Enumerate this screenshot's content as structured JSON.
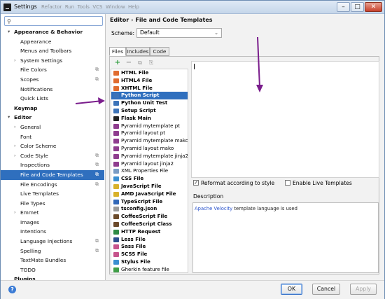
{
  "window": {
    "title": "Settings",
    "ghost_menu": "Refactor  Run  Tools  VCS  Window  Help"
  },
  "search": {
    "placeholder": "",
    "value": ""
  },
  "tree": [
    {
      "label": "Appearance & Behavior",
      "level": 0,
      "expanded": true,
      "bold": true
    },
    {
      "label": "Appearance",
      "level": 1
    },
    {
      "label": "Menus and Toolbars",
      "level": 1
    },
    {
      "label": "System Settings",
      "level": 1,
      "collapsed": true
    },
    {
      "label": "File Colors",
      "level": 1,
      "cfg": true
    },
    {
      "label": "Scopes",
      "level": 1,
      "cfg": true
    },
    {
      "label": "Notifications",
      "level": 1
    },
    {
      "label": "Quick Lists",
      "level": 1
    },
    {
      "label": "Keymap",
      "level": 0,
      "bold": true
    },
    {
      "label": "Editor",
      "level": 0,
      "expanded": true,
      "bold": true
    },
    {
      "label": "General",
      "level": 1,
      "collapsed": true
    },
    {
      "label": "Font",
      "level": 1
    },
    {
      "label": "Color Scheme",
      "level": 1,
      "collapsed": true
    },
    {
      "label": "Code Style",
      "level": 1,
      "collapsed": true,
      "cfg": true
    },
    {
      "label": "Inspections",
      "level": 1,
      "cfg": true
    },
    {
      "label": "File and Code Templates",
      "level": 1,
      "cfg": true,
      "selected": true
    },
    {
      "label": "File Encodings",
      "level": 1,
      "cfg": true
    },
    {
      "label": "Live Templates",
      "level": 1
    },
    {
      "label": "File Types",
      "level": 1
    },
    {
      "label": "Emmet",
      "level": 1,
      "collapsed": true
    },
    {
      "label": "Images",
      "level": 1
    },
    {
      "label": "Intentions",
      "level": 1
    },
    {
      "label": "Language Injections",
      "level": 1,
      "cfg": true
    },
    {
      "label": "Spelling",
      "level": 1,
      "cfg": true
    },
    {
      "label": "TextMate Bundles",
      "level": 1
    },
    {
      "label": "TODO",
      "level": 1
    },
    {
      "label": "Plugins",
      "level": 0,
      "bold": true
    }
  ],
  "breadcrumb": {
    "part1": "Editor",
    "separator": "›",
    "part2": "File and Code Templates"
  },
  "scheme": {
    "label": "Scheme:",
    "value": "Default"
  },
  "tabs": [
    {
      "label": "Files",
      "active": true
    },
    {
      "label": "Includes"
    },
    {
      "label": "Code"
    }
  ],
  "toolbar": {
    "add": "+",
    "remove": "−",
    "copy": "⧉",
    "reset": "⎘"
  },
  "templates": [
    {
      "label": "HTML File",
      "bold": true,
      "icon": "html"
    },
    {
      "label": "HTML4 File",
      "bold": true,
      "icon": "html"
    },
    {
      "label": "XHTML File",
      "bold": true,
      "icon": "html"
    },
    {
      "label": "Python Script",
      "bold": true,
      "icon": "py",
      "selected": true
    },
    {
      "label": "Python Unit Test",
      "bold": true,
      "icon": "py"
    },
    {
      "label": "Setup Script",
      "bold": true,
      "icon": "py"
    },
    {
      "label": "Flask Main",
      "bold": true,
      "icon": "flask"
    },
    {
      "label": "Pyramid mytemplate pt",
      "bold": false,
      "icon": "pyr"
    },
    {
      "label": "Pyramid layout pt",
      "bold": false,
      "icon": "pyr"
    },
    {
      "label": "Pyramid mytemplate mako",
      "bold": false,
      "icon": "pyr"
    },
    {
      "label": "Pyramid layout mako",
      "bold": false,
      "icon": "pyr"
    },
    {
      "label": "Pyramid mytemplate jinja2",
      "bold": false,
      "icon": "pyr"
    },
    {
      "label": "Pyramid layout jinja2",
      "bold": false,
      "icon": "pyr"
    },
    {
      "label": "XML Properties File",
      "bold": false,
      "icon": "xml"
    },
    {
      "label": "CSS File",
      "bold": true,
      "icon": "css"
    },
    {
      "label": "JavaScript File",
      "bold": true,
      "icon": "js"
    },
    {
      "label": "AMD JavaScript File",
      "bold": true,
      "icon": "js"
    },
    {
      "label": "TypeScript File",
      "bold": true,
      "icon": "ts"
    },
    {
      "label": "tsconfig.json",
      "bold": true,
      "icon": "json"
    },
    {
      "label": "CoffeeScript File",
      "bold": true,
      "icon": "cs"
    },
    {
      "label": "CoffeeScript Class",
      "bold": true,
      "icon": "cs"
    },
    {
      "label": "HTTP Request",
      "bold": true,
      "icon": "http"
    },
    {
      "label": "Less File",
      "bold": true,
      "icon": "less"
    },
    {
      "label": "Sass File",
      "bold": true,
      "icon": "sass"
    },
    {
      "label": "SCSS File",
      "bold": true,
      "icon": "sass"
    },
    {
      "label": "Stylus File",
      "bold": true,
      "icon": "css"
    },
    {
      "label": "Gherkin feature file",
      "bold": false,
      "icon": "gh"
    }
  ],
  "options": {
    "reformat": "Reformat according to style",
    "reformat_checked": true,
    "live": "Enable Live Templates",
    "live_checked": false
  },
  "description": {
    "label": "Description",
    "link": "Apache Velocity",
    "text": " template language is used"
  },
  "buttons": {
    "ok": "OK",
    "cancel": "Cancel",
    "apply": "Apply",
    "help": "?"
  },
  "colors": {
    "selection": "#2f6fbe",
    "annotation_arrow": "#7a1d8c"
  }
}
